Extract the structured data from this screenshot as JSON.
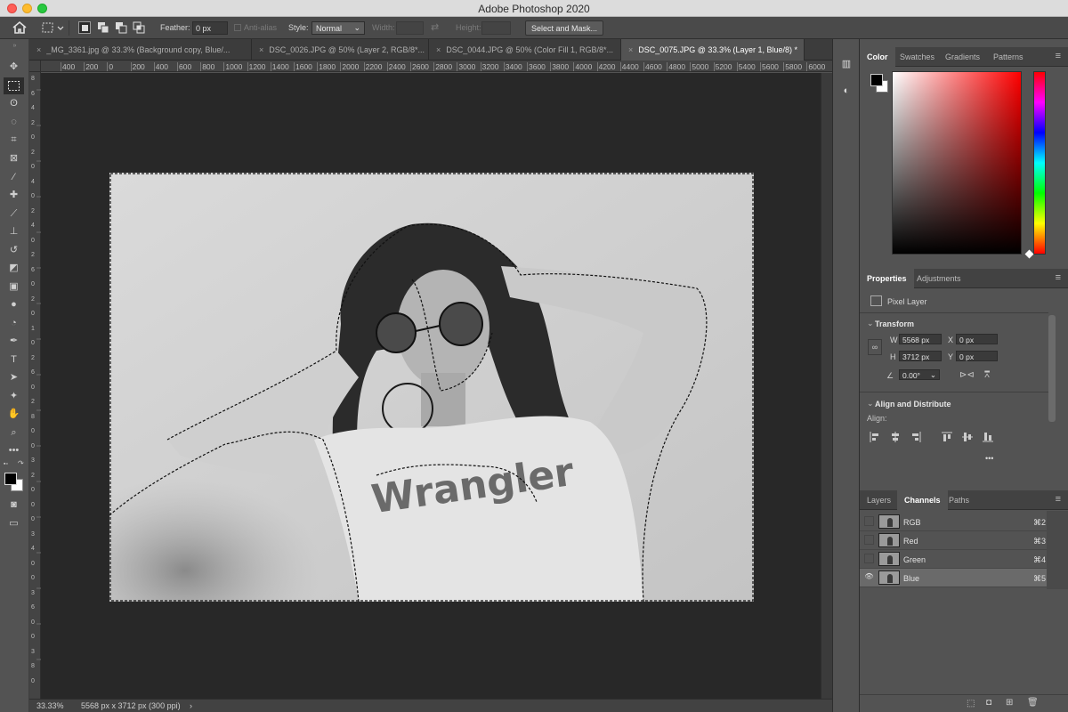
{
  "window": {
    "title": "Adobe Photoshop 2020"
  },
  "options_bar": {
    "feather_label": "Feather:",
    "feather_value": "0 px",
    "anti_alias_label": "Anti-alias",
    "style_label": "Style:",
    "style_value": "Normal",
    "width_label": "Width:",
    "height_label": "Height:",
    "select_mask_label": "Select and Mask..."
  },
  "tabs": [
    {
      "label": "_MG_3361.jpg @ 33.3% (Background copy, Blue/...",
      "active": false
    },
    {
      "label": "DSC_0026.JPG @ 50% (Layer 2, RGB/8*...",
      "active": false
    },
    {
      "label": "DSC_0044.JPG @ 50% (Color Fill 1, RGB/8*...",
      "active": false
    },
    {
      "label": "DSC_0075.JPG @ 33.3% (Layer 1, Blue/8) *",
      "active": true
    }
  ],
  "ruler_top": [
    "400",
    "200",
    "0",
    "200",
    "400",
    "600",
    "800",
    "1000",
    "1200",
    "1400",
    "1600",
    "1800",
    "2000",
    "2200",
    "2400",
    "2600",
    "2800",
    "3000",
    "3200",
    "3400",
    "3600",
    "3800",
    "4000",
    "4200",
    "4400",
    "4600",
    "4800",
    "5000",
    "5200",
    "5400",
    "5600",
    "5800",
    "6000"
  ],
  "ruler_left": [
    "8",
    "6",
    "4",
    "2",
    "0",
    "2",
    "0",
    "4",
    "0",
    "2",
    "4",
    "0",
    "2",
    "6",
    "0",
    "2",
    "0",
    "1",
    "0",
    "2",
    "6",
    "0",
    "2",
    "8",
    "0",
    "0",
    "3",
    "2",
    "0",
    "0",
    "0",
    "3",
    "4",
    "0",
    "0",
    "3",
    "6",
    "0",
    "0",
    "3",
    "8",
    "0"
  ],
  "status_bar": {
    "zoom": "33.33%",
    "doc_info": "5568 px x 3712 px (300 ppi)",
    "arrow": "›"
  },
  "color_panel": {
    "tabs": [
      "Color",
      "Swatches",
      "Gradients",
      "Patterns"
    ],
    "active_tab": "Color",
    "foreground": "#000000",
    "background": "#ffffff",
    "hue_color": "#ff0000"
  },
  "properties_panel": {
    "tabs": [
      "Properties",
      "Adjustments"
    ],
    "layer_type": "Pixel Layer",
    "transform_title": "Transform",
    "w_label": "W",
    "w_value": "5568 px",
    "x_label": "X",
    "x_value": "0 px",
    "h_label": "H",
    "h_value": "3712 px",
    "y_label": "Y",
    "y_value": "0 px",
    "angle_value": "0.00°",
    "align_title": "Align and Distribute",
    "align_label": "Align:",
    "more": "•••"
  },
  "channels_panel": {
    "tabs": [
      "Layers",
      "Channels",
      "Paths"
    ],
    "active_tab": "Channels",
    "channels": [
      {
        "name": "RGB",
        "shortcut": "⌘2",
        "visible": false,
        "selected": false
      },
      {
        "name": "Red",
        "shortcut": "⌘3",
        "visible": false,
        "selected": false
      },
      {
        "name": "Green",
        "shortcut": "⌘4",
        "visible": false,
        "selected": false
      },
      {
        "name": "Blue",
        "shortcut": "⌘5",
        "visible": true,
        "selected": true
      }
    ]
  },
  "colors": {
    "panel_bg": "#535353",
    "canvas_bg": "#282828",
    "active_channel": "#6a6a6a",
    "close_button": "#fe5f57",
    "minimize_button": "#febc2e",
    "maximize_button": "#28c840"
  }
}
